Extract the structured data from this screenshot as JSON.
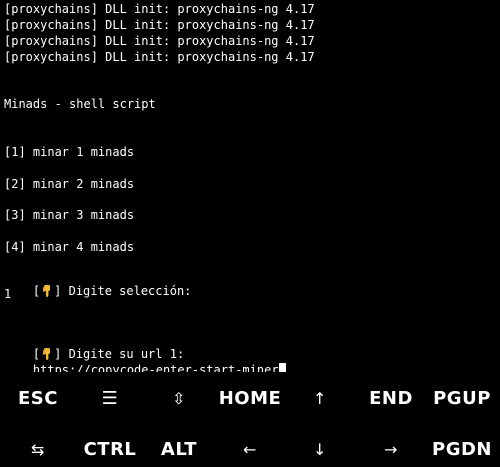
{
  "terminal": {
    "lines": {
      "l1": "[proxychains] DLL init: proxychains-ng 4.17",
      "l2": "[proxychains] DLL init: proxychains-ng 4.17",
      "l3": "[proxychains] DLL init: proxychains-ng 4.17",
      "l4": "[proxychains] DLL init: proxychains-ng 4.17",
      "title": "Minads - shell script",
      "opt1": "[1] minar 1 minads",
      "opt2": "[2] minar 2 minads",
      "opt3": "[3] minar 3 minads",
      "opt4": "[4] minar 4 minads",
      "prompt1_before": "[",
      "prompt1_after": "] Digite selección:",
      "answer1": "1",
      "prompt2_before": "[",
      "prompt2_after": "] Digite su url 1:",
      "input": "https://copycode-enter-start-miner"
    },
    "emoji_icon": "pointing-down-hand-icon"
  },
  "extra_keys": {
    "row1": {
      "esc": "ESC",
      "menu": "☰",
      "updown": "⇳",
      "home": "HOME",
      "up": "↑",
      "end": "END",
      "pgup": "PGUP"
    },
    "row2": {
      "tab": "⇆",
      "ctrl": "CTRL",
      "alt": "ALT",
      "left": "←",
      "down": "↓",
      "right": "→",
      "pgdn": "PGDN"
    }
  },
  "colors": {
    "background": "#000000",
    "text": "#ffffff",
    "emoji": "#f5b82e"
  }
}
